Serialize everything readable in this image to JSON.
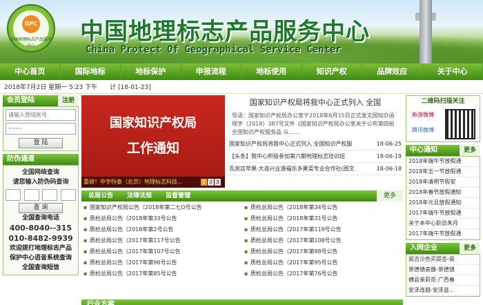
{
  "header": {
    "logo_text": "GPC",
    "logo_ring": "中国地理标志产品服务中心",
    "title": "中国地理标志产品服务中心",
    "subtitle": "China Protect Of Geographical Service Center"
  },
  "nav": [
    "中心首页",
    "国际地标",
    "地标保护",
    "申报流程",
    "地标使用",
    "知识产权",
    "品牌效应",
    "关于中心"
  ],
  "datebar": {
    "date": "2018年7月2日 星期一 5:23 下午",
    "code": "计 [18-01-23]"
  },
  "login": {
    "heading": "会员登陆",
    "register": "注册",
    "account_placeholder": "请输入登陆账号",
    "password_value": "········",
    "login_button": "登 陆"
  },
  "anti_fake": {
    "heading": "防伪通道",
    "line1": "全国网络查询",
    "line2": "请您输入防伪码查询",
    "query_button": "查 询"
  },
  "contact": {
    "line1": "全国查询电话",
    "phone1": "400-8040--315",
    "phone2": "010-8482-9939",
    "line2": "欢迎拨打地理标志产品",
    "line3": "保护中心语音系统查询",
    "line4": "全国查询短信"
  },
  "slider": {
    "line1": "国家知识产权局",
    "line2": "工作通知",
    "caption": "重磅！中宇恒泰（北京）地理标志科技...",
    "pages": [
      "1",
      "2",
      "3"
    ]
  },
  "headline": {
    "title": "国家知识产权局将我中心正式列入 全国",
    "desc": "导语：国家知识产权局办公室于2018年6月15日正式发文国知办函规字（2018）387号文件《国家知识产权局办公室关于公布第四批全国知识产权服务品 众……",
    "rows": [
      {
        "t": "国家知识产权局将我中心正式列入 全国知识产权服",
        "d": "18-06-25"
      },
      {
        "t": "【头条】我中心积极参加第六期地理标志培训班",
        "d": "18-06-19"
      },
      {
        "t": "瓦房店苹果·大连兴业源福乐多果菜专业合作社(图文",
        "d": "18-06-18"
      }
    ]
  },
  "tabs": [
    "总局公告",
    "法律法规",
    "监督管理"
  ],
  "more": "更多",
  "notices": [
    [
      "国家知识产权局公告（2018年第二七O号公告",
      "质检总局公告（2018年第34号公告"
    ],
    [
      "质检总局公告（2018年第33号公告",
      "质检总局公告（2018年第31号公告"
    ],
    [
      "质检总局公告（2018年第2号公告",
      "质检总局公告（2017年第119号公告"
    ],
    [
      "质检总局公告（2017年第117号公告",
      "质检总局公告（2017年第108号公告"
    ],
    [
      "质检总局公告（2017年第107号公告",
      "质检总局公告（2017年第98号公告"
    ],
    [
      "质检总局公告（2017年第96号公告",
      "质检总局公告（2017年第95号公告"
    ],
    [
      "质检总局公告（2017年第85号公告",
      "质检总局公告（2017年第76号公告"
    ]
  ],
  "industry": "行业方案",
  "qr": {
    "title": "二维码扫描关注",
    "weibo1": "新浪微博",
    "weibo2": "腾讯微博"
  },
  "center_notice": {
    "heading": "中心通知",
    "items": [
      "2018年端午节放假通",
      "2018年五一节放假通",
      "2018年清明节假安",
      "2018年春节放假通知",
      "2018年元旦放假通知",
      "2017年端午节放假通",
      "关于本中心职员朱月",
      "2017年端午节放假通"
    ]
  },
  "members": {
    "heading": "入网企业",
    "items": [
      "英吉沙色买提杏-英",
      "景德镇瓷器-景德镇",
      "横县茉莉花-广西春",
      "安泽连翘-安泽县..."
    ]
  },
  "colors": {
    "nav": "#4f9a1c",
    "title": "#1d7a2c",
    "slider": "#c8281e"
  }
}
